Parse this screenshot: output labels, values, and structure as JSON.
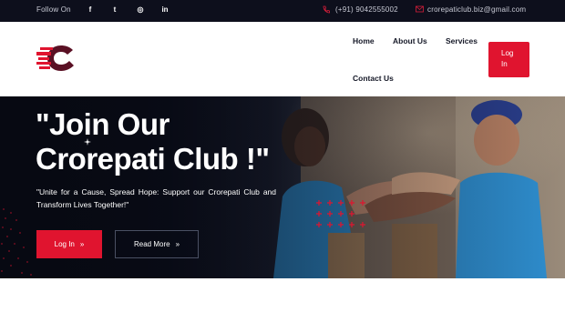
{
  "topbar": {
    "follow_label": "Follow On",
    "social": [
      {
        "name": "facebook-icon",
        "glyph": "f"
      },
      {
        "name": "twitter-icon",
        "glyph": "t"
      },
      {
        "name": "instagram-icon",
        "glyph": "◎"
      },
      {
        "name": "linkedin-icon",
        "glyph": "in"
      }
    ],
    "phone": "(+91) 9042555002",
    "email": "crorepaticlub.biz@gmail.com"
  },
  "nav": {
    "home": "Home",
    "about": "About Us",
    "services": "Services",
    "contact": "Contact Us",
    "login": "Log In"
  },
  "hero": {
    "title": "\"Join Our Crorepati Club !\"",
    "subtitle": "\"Unite for a Cause, Spread Hope: Support our Crorepati Club and Transform Lives Together!\"",
    "login_button": "Log In",
    "read_more_button": "Read More",
    "arrow_glyph": "»"
  },
  "colors": {
    "accent": "#e0142f",
    "dark": "#0d0f1c"
  }
}
